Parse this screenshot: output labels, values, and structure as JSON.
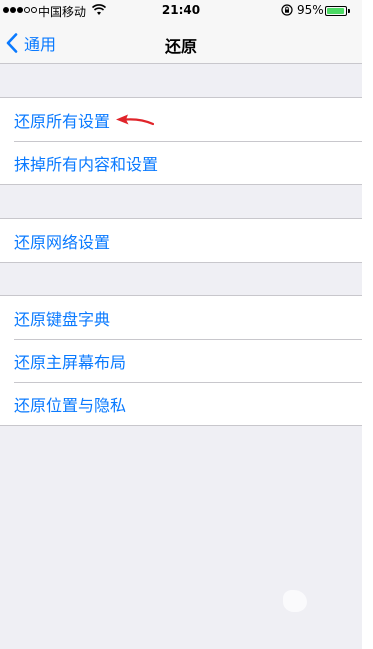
{
  "status_bar": {
    "carrier": "中国移动",
    "time": "21:40",
    "battery_percent": "95%",
    "battery_level": 0.95,
    "icons": [
      "signal-icon",
      "wifi-icon",
      "orientation-lock-icon",
      "battery-icon"
    ]
  },
  "nav": {
    "back_label": "通用",
    "title": "还原"
  },
  "groups": [
    {
      "items": [
        {
          "label": "还原所有设置"
        },
        {
          "label": "抹掉所有内容和设置"
        }
      ]
    },
    {
      "items": [
        {
          "label": "还原网络设置"
        }
      ]
    },
    {
      "items": [
        {
          "label": "还原键盘字典"
        },
        {
          "label": "还原主屏幕布局"
        },
        {
          "label": "还原位置与隐私"
        }
      ]
    }
  ],
  "colors": {
    "accent": "#0a7aff",
    "background": "#efeff4",
    "annotation_arrow": "#e0242a",
    "battery": "#4cd964"
  }
}
